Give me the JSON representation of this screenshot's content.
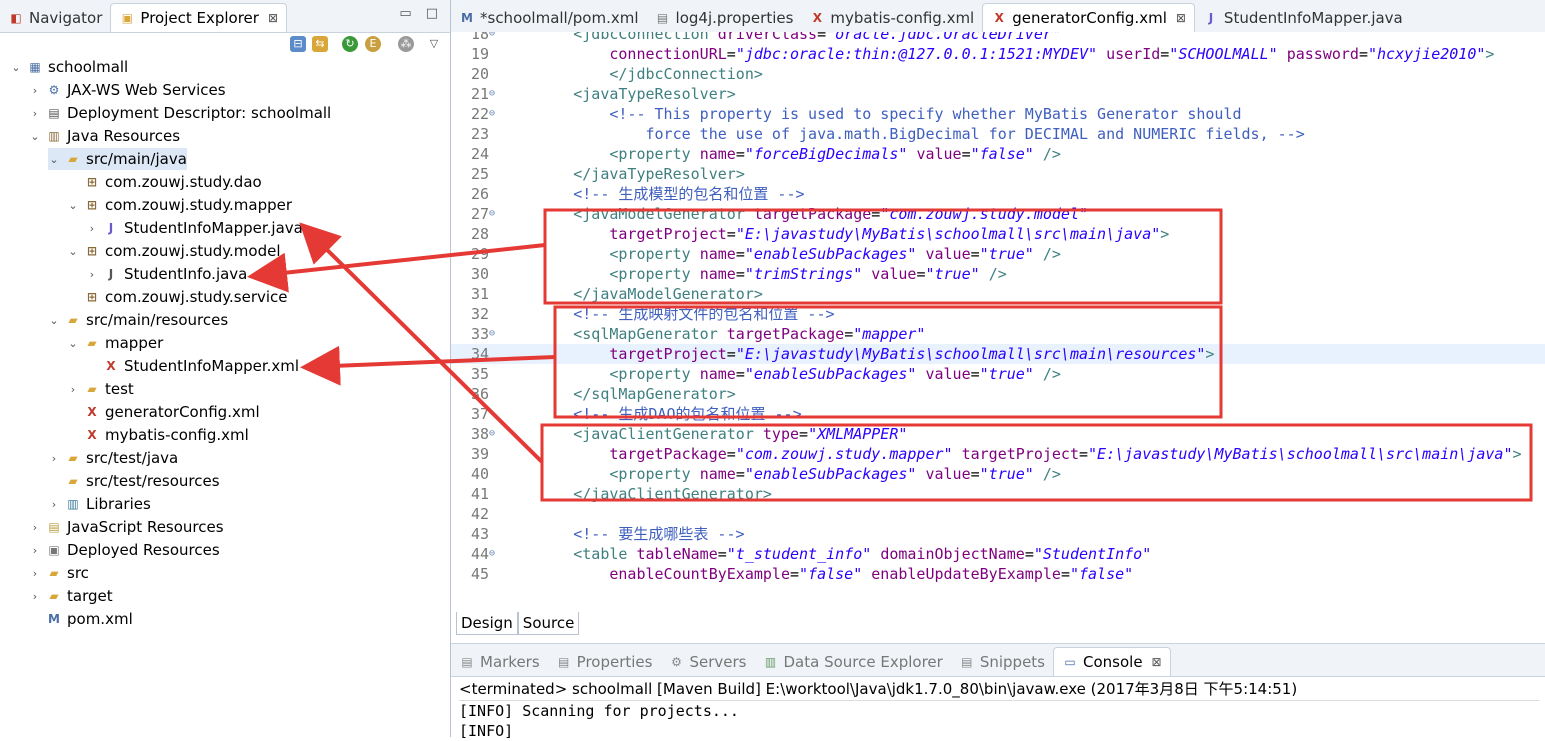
{
  "left_tabs": [
    {
      "label": "Navigator",
      "icon": "navigator-icon"
    },
    {
      "label": "Project Explorer",
      "icon": "project-explorer-icon",
      "close": "⊠"
    }
  ],
  "tree": [
    {
      "label": "schoolmall",
      "icon": "project-icon",
      "indent": 0,
      "twisty": "expanded"
    },
    {
      "label": "JAX-WS Web Services",
      "icon": "webservice-icon",
      "indent": 1,
      "twisty": "collapsed"
    },
    {
      "label": "Deployment Descriptor: schoolmall",
      "icon": "descriptor-icon",
      "indent": 1,
      "twisty": "collapsed"
    },
    {
      "label": "Java Resources",
      "icon": "java-resources-icon",
      "indent": 1,
      "twisty": "expanded"
    },
    {
      "label": "src/main/java",
      "icon": "source-folder-icon",
      "indent": 2,
      "twisty": "expanded",
      "selected": true
    },
    {
      "label": "com.zouwj.study.dao",
      "icon": "package-icon",
      "indent": 3,
      "twisty": "none"
    },
    {
      "label": "com.zouwj.study.mapper",
      "icon": "package-icon",
      "indent": 3,
      "twisty": "expanded"
    },
    {
      "label": "StudentInfoMapper.java",
      "icon": "java-interface-icon",
      "indent": 4,
      "twisty": "collapsed"
    },
    {
      "label": "com.zouwj.study.model",
      "icon": "package-icon",
      "indent": 3,
      "twisty": "expanded"
    },
    {
      "label": "StudentInfo.java",
      "icon": "java-file-icon",
      "indent": 4,
      "twisty": "collapsed"
    },
    {
      "label": "com.zouwj.study.service",
      "icon": "package-icon",
      "indent": 3,
      "twisty": "none"
    },
    {
      "label": "src/main/resources",
      "icon": "source-folder-icon",
      "indent": 2,
      "twisty": "expanded"
    },
    {
      "label": "mapper",
      "icon": "folder-icon",
      "indent": 3,
      "twisty": "expanded"
    },
    {
      "label": "StudentInfoMapper.xml",
      "icon": "xml-file-icon",
      "indent": 4,
      "twisty": "none"
    },
    {
      "label": "test",
      "icon": "folder-icon",
      "indent": 3,
      "twisty": "collapsed"
    },
    {
      "label": "generatorConfig.xml",
      "icon": "xml-file-icon",
      "indent": 3,
      "twisty": "none"
    },
    {
      "label": "mybatis-config.xml",
      "icon": "xml-file-icon",
      "indent": 3,
      "twisty": "none"
    },
    {
      "label": "src/test/java",
      "icon": "source-folder-icon",
      "indent": 2,
      "twisty": "collapsed"
    },
    {
      "label": "src/test/resources",
      "icon": "source-folder-icon",
      "indent": 2,
      "twisty": "none"
    },
    {
      "label": "Libraries",
      "icon": "library-icon",
      "indent": 2,
      "twisty": "collapsed"
    },
    {
      "label": "JavaScript Resources",
      "icon": "js-resources-icon",
      "indent": 1,
      "twisty": "collapsed"
    },
    {
      "label": "Deployed Resources",
      "icon": "deployed-icon",
      "indent": 1,
      "twisty": "collapsed"
    },
    {
      "label": "src",
      "icon": "folder-icon",
      "indent": 1,
      "twisty": "collapsed"
    },
    {
      "label": "target",
      "icon": "folder-icon",
      "indent": 1,
      "twisty": "collapsed"
    },
    {
      "label": "pom.xml",
      "icon": "pom-file-icon",
      "indent": 1,
      "twisty": "none"
    }
  ],
  "editor_tabs": [
    {
      "label": "*schoolmall/pom.xml",
      "icon": "pom-file-icon",
      "active": false
    },
    {
      "label": "log4j.properties",
      "icon": "properties-file-icon",
      "active": false
    },
    {
      "label": "mybatis-config.xml",
      "icon": "xml-file-icon",
      "active": false
    },
    {
      "label": "generatorConfig.xml",
      "icon": "xml-file-icon",
      "active": true,
      "close": "⊠"
    },
    {
      "label": "StudentInfoMapper.java",
      "icon": "java-interface-icon",
      "active": false
    }
  ],
  "code_lines": [
    {
      "num": "18",
      "fold": "⊖",
      "text": "        <jdbcConnection driverClass=\"oracle.jdbc.OracleDriver\""
    },
    {
      "num": "19",
      "fold": "",
      "text": "            connectionURL=\"jdbc:oracle:thin:@127.0.0.1:1521:MYDEV\" userId=\"SCHOOLMALL\" password=\"hcxyjie2010\">"
    },
    {
      "num": "20",
      "fold": "",
      "text": "            </jdbcConnection>"
    },
    {
      "num": "21",
      "fold": "⊖",
      "text": "        <javaTypeResolver>"
    },
    {
      "num": "22",
      "fold": "⊖",
      "text": "            <!-- This property is used to specify whether MyBatis Generator should"
    },
    {
      "num": "23",
      "fold": "",
      "text": "                force the use of java.math.BigDecimal for DECIMAL and NUMERIC fields, -->"
    },
    {
      "num": "24",
      "fold": "",
      "text": "            <property name=\"forceBigDecimals\" value=\"false\" />"
    },
    {
      "num": "25",
      "fold": "",
      "text": "        </javaTypeResolver>"
    },
    {
      "num": "26",
      "fold": "",
      "text": "        <!-- 生成模型的包名和位置 -->"
    },
    {
      "num": "27",
      "fold": "⊖",
      "text": "        <javaModelGenerator targetPackage=\"com.zouwj.study.model\""
    },
    {
      "num": "28",
      "fold": "",
      "text": "            targetProject=\"E:\\javastudy\\MyBatis\\schoolmall\\src\\main\\java\">"
    },
    {
      "num": "29",
      "fold": "",
      "text": "            <property name=\"enableSubPackages\" value=\"true\" />"
    },
    {
      "num": "30",
      "fold": "",
      "text": "            <property name=\"trimStrings\" value=\"true\" />"
    },
    {
      "num": "31",
      "fold": "",
      "text": "        </javaModelGenerator>"
    },
    {
      "num": "32",
      "fold": "",
      "text": "        <!-- 生成映射文件的包名和位置 -->"
    },
    {
      "num": "33",
      "fold": "⊖",
      "text": "        <sqlMapGenerator targetPackage=\"mapper\""
    },
    {
      "num": "34",
      "fold": "",
      "text": "            targetProject=\"E:\\javastudy\\MyBatis\\schoolmall\\src\\main\\resources\">",
      "highlight": true
    },
    {
      "num": "35",
      "fold": "",
      "text": "            <property name=\"enableSubPackages\" value=\"true\" />"
    },
    {
      "num": "36",
      "fold": "",
      "text": "        </sqlMapGenerator>"
    },
    {
      "num": "37",
      "fold": "",
      "text": "        <!-- 生成DAO的包名和位置 -->"
    },
    {
      "num": "38",
      "fold": "⊖",
      "text": "        <javaClientGenerator type=\"XMLMAPPER\""
    },
    {
      "num": "39",
      "fold": "",
      "text": "            targetPackage=\"com.zouwj.study.mapper\" targetProject=\"E:\\javastudy\\MyBatis\\schoolmall\\src\\main\\java\">"
    },
    {
      "num": "40",
      "fold": "",
      "text": "            <property name=\"enableSubPackages\" value=\"true\" />"
    },
    {
      "num": "41",
      "fold": "",
      "text": "        </javaClientGenerator>"
    },
    {
      "num": "42",
      "fold": "",
      "text": ""
    },
    {
      "num": "43",
      "fold": "",
      "text": "        <!-- 要生成哪些表 -->"
    },
    {
      "num": "44",
      "fold": "⊖",
      "text": "        <table tableName=\"t_student_info\" domainObjectName=\"StudentInfo\""
    },
    {
      "num": "45",
      "fold": "",
      "text": "            enableCountByExample=\"false\" enableUpdateByExample=\"false\""
    }
  ],
  "design_tabs": {
    "design": "Design",
    "source": "Source"
  },
  "bottom_tabs": [
    {
      "label": "Markers",
      "icon": "markers-icon"
    },
    {
      "label": "Properties",
      "icon": "properties-icon"
    },
    {
      "label": "Servers",
      "icon": "servers-icon"
    },
    {
      "label": "Data Source Explorer",
      "icon": "data-source-icon"
    },
    {
      "label": "Snippets",
      "icon": "snippets-icon"
    },
    {
      "label": "Console",
      "icon": "console-icon",
      "active": true,
      "close": "⊠"
    }
  ],
  "console": {
    "status": "<terminated> schoolmall [Maven Build] E:\\worktool\\Java\\jdk1.7.0_80\\bin\\javaw.exe (2017年3月8日 下午5:14:51)",
    "lines": [
      "[INFO] Scanning for projects...",
      "[INFO]"
    ]
  },
  "colors": {
    "annotation": "#e53935",
    "tag": "#3f7f7f",
    "attr": "#7f007f",
    "value": "#2a00ff",
    "comment": "#3f5fbf",
    "selection": "#dce8f5"
  }
}
